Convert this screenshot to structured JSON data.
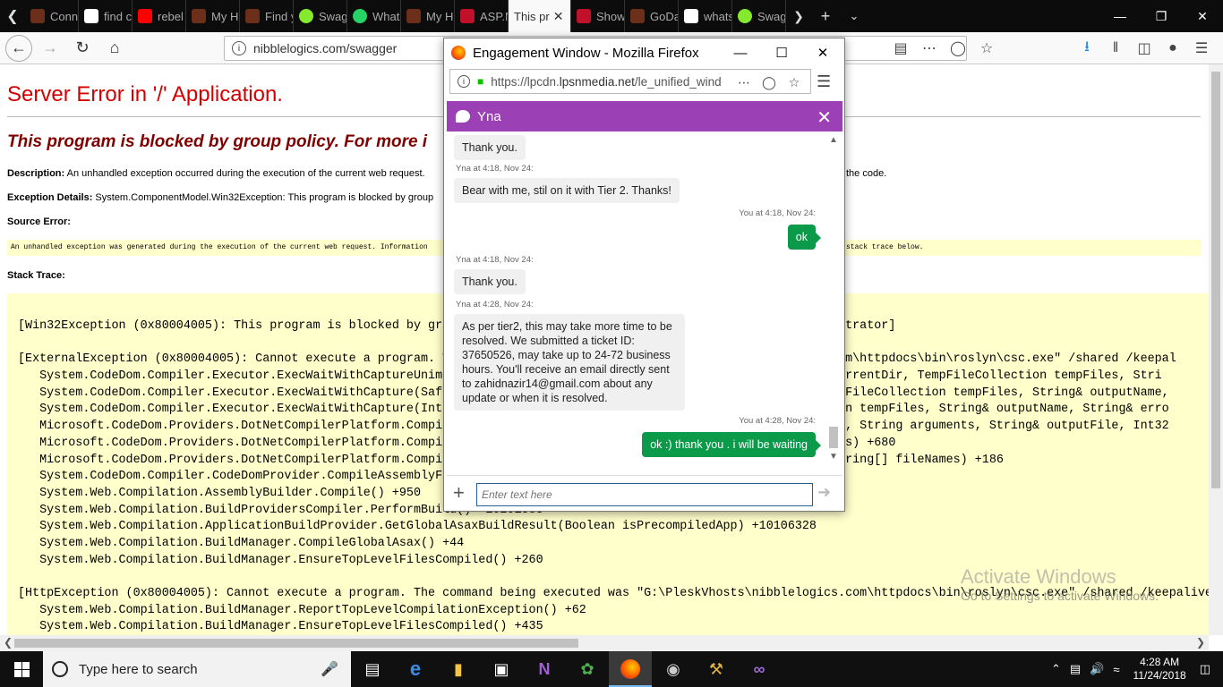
{
  "browser": {
    "tabs": [
      {
        "label": "Conne",
        "icon": "logo-icon"
      },
      {
        "label": "find cc",
        "icon": "google-icon"
      },
      {
        "label": "rebel r",
        "icon": "youtube-icon"
      },
      {
        "label": "My Ho",
        "icon": "logo-icon"
      },
      {
        "label": "Find y",
        "icon": "logo-icon"
      },
      {
        "label": "Swagg",
        "icon": "swagger-icon"
      },
      {
        "label": "Whats",
        "icon": "whatsapp-icon"
      },
      {
        "label": "My Ho",
        "icon": "logo-icon"
      },
      {
        "label": "ASP.N",
        "icon": "asp-icon"
      },
      {
        "label": "This pr",
        "icon": "",
        "active": true
      },
      {
        "label": "Show",
        "icon": "asp-icon"
      },
      {
        "label": "GoDad",
        "icon": "logo-icon"
      },
      {
        "label": "whats",
        "icon": "google-icon"
      },
      {
        "label": "Swagg",
        "icon": "swagger-icon"
      }
    ],
    "url": "nibblelogics.com/swagger"
  },
  "page": {
    "title": "Server Error in '/' Application.",
    "subtitle": "This program is blocked by group policy. For more i",
    "description_label": "Description:",
    "description_text": "An unhandled exception occurred during the execution of the current web request.",
    "description_tail": "the code.",
    "exception_label": "Exception Details:",
    "exception_text": "System.ComponentModel.Win32Exception: This program is blocked by group",
    "source_label": "Source Error:",
    "source_text": "An unhandled exception was generated during the execution of the current web request. Information",
    "source_tail": "stack trace below.",
    "stack_label": "Stack Trace:",
    "stack_lines": [
      "[Win32Exception (0x80004005): This program is blocked by gro                                                   inistrator]",
      "",
      "[ExternalException (0x80004005): Cannot execute a program. T                                                  cs.com\\httpdocs\\bin\\roslyn\\csc.exe\" /shared /keepal",
      "   System.CodeDom.Compiler.Executor.ExecWaitWithCaptureUnimp                                                 ing currentDir, TempFileCollection tempFiles, Stri",
      "   System.CodeDom.Compiler.Executor.ExecWaitWithCapture(Safe                                                 , TempFileCollection tempFiles, String& outputName,",
      "   System.CodeDom.Compiler.Executor.ExecWaitWithCapture(IntP                                                 lection tempFiles, String& outputName, String& erro",
      "   Microsoft.CodeDom.Providers.DotNetCompilerPlatform.Compil                                                 llPath, String arguments, String& outputFile, Int32",
      "   Microsoft.CodeDom.Providers.DotNetCompilerPlatform.Compil                                                 leNames) +680",
      "   Microsoft.CodeDom.Providers.DotNetCompilerPlatform.Compil                                                 ns, String[] fileNames) +186",
      "   System.CodeDom.Compiler.CodeDomProvider.CompileAssemblyFr                                                 24",
      "   System.Web.Compilation.AssemblyBuilder.Compile() +950",
      "   System.Web.Compilation.BuildProvidersCompiler.PerformBuild() +10201585",
      "   System.Web.Compilation.ApplicationBuildProvider.GetGlobalAsaxBuildResult(Boolean isPrecompiledApp) +10106328",
      "   System.Web.Compilation.BuildManager.CompileGlobalAsax() +44",
      "   System.Web.Compilation.BuildManager.EnsureTopLevelFilesCompiled() +260",
      "",
      "[HttpException (0x80004005): Cannot execute a program. The command being executed was \"G:\\PleskVhosts\\nibblelogics.com\\httpdocs\\bin\\roslyn\\csc.exe\" /shared /keepalive",
      "   System.Web.Compilation.BuildManager.ReportTopLevelCompilationException() +62",
      "   System.Web.Compilation.BuildManager.EnsureTopLevelFilesCompiled() +435"
    ],
    "watermark_title": "Activate Windows",
    "watermark_text": "Go to Settings to activate Windows."
  },
  "popup": {
    "window_title": "Engagement Window - Mozilla Firefox",
    "url_prefix": "https://lpcdn.",
    "url_domain": "lpsnmedia.net",
    "url_rest": "/le_unified_wind",
    "agent_name": "Yna",
    "messages": [
      {
        "from": "agent",
        "meta": "",
        "text": "Thank you."
      },
      {
        "from": "agent",
        "meta": "Yna at 4:18, Nov 24:",
        "text": "Bear with me, stil on it with Tier 2. Thanks!"
      },
      {
        "from": "me",
        "meta": "You at 4:18, Nov 24:",
        "text": "ok"
      },
      {
        "from": "agent",
        "meta": "Yna at 4:18, Nov 24:",
        "text": "Thank you."
      },
      {
        "from": "agent",
        "meta": "Yna at 4:28, Nov 24:",
        "text": "As per tier2, this may take more time to be resolved. We submitted a ticket ID: 37650526, may take up to 24-72 business hours. You'll receive an email directly sent to zahidnazir14@gmail.com about any update or when it is resolved."
      },
      {
        "from": "me",
        "meta": "You at 4:28, Nov 24:",
        "text": "ok :) thank you . i will be waiting"
      }
    ],
    "input_placeholder": "Enter text here"
  },
  "taskbar": {
    "search_placeholder": "Type here to search",
    "time": "4:28 AM",
    "date": "11/24/2018"
  }
}
